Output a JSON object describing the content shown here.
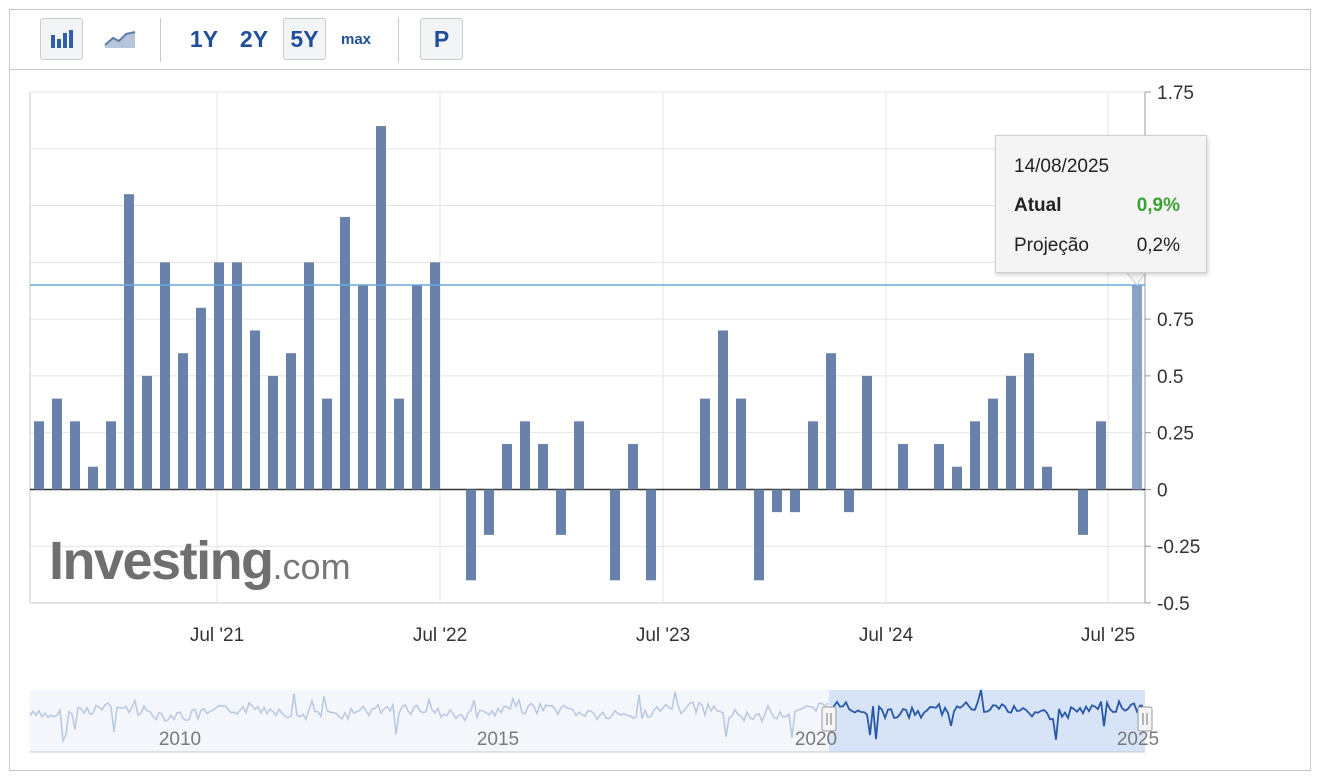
{
  "toolbar": {
    "buttons": [
      "1Y",
      "2Y",
      "5Y",
      "max",
      "P"
    ],
    "active": "5Y",
    "icons": [
      "bar-chart-icon",
      "area-chart-icon"
    ]
  },
  "logo": {
    "brand": "Investing",
    "suffix": ".com"
  },
  "tooltip": {
    "date": "14/08/2025",
    "actual_label": "Atual",
    "actual_value": "0,9%",
    "forecast_label": "Projeção",
    "forecast_value": "0,2%",
    "colors": {
      "actual": "#3aa233"
    }
  },
  "colors": {
    "bar": "#6882ac",
    "highlight_bar": "#8aa0c4",
    "reference_line": "#6aaae2",
    "navigator_line": "#2858a8",
    "navigator_fill": "#d7e3f7"
  },
  "chart_data": {
    "type": "bar",
    "ylim": [
      -0.5,
      1.75
    ],
    "yticks_labels": [
      "1.75",
      "0.75",
      "0.5",
      "0.25",
      "0",
      "-0.25",
      "-0.5"
    ],
    "yticks_values": [
      1.75,
      0.75,
      0.5,
      0.25,
      0,
      -0.25,
      -0.5
    ],
    "gridline_values": [
      1.75,
      1.5,
      1.25,
      1.0,
      0.75,
      0.5,
      0.25,
      0,
      -0.25,
      -0.5
    ],
    "x_labels": [
      "Jul '21",
      "Jul '22",
      "Jul '23",
      "Jul '24",
      "Jul '25"
    ],
    "reference_value": 0.9,
    "values": [
      0.3,
      0.4,
      0.3,
      0.1,
      0.3,
      1.3,
      0.5,
      1.0,
      0.6,
      0.8,
      1.0,
      1.0,
      0.7,
      0.5,
      0.6,
      1.0,
      0.4,
      1.2,
      0.9,
      1.6,
      0.4,
      0.9,
      1.0,
      null,
      -0.4,
      -0.2,
      0.2,
      0.3,
      0.2,
      -0.2,
      0.3,
      null,
      -0.4,
      0.2,
      -0.4,
      null,
      null,
      0.4,
      0.7,
      0.4,
      -0.4,
      -0.1,
      -0.1,
      0.3,
      0.6,
      -0.1,
      0.5,
      null,
      0.2,
      null,
      0.2,
      0.1,
      0.3,
      0.4,
      0.5,
      0.6,
      0.1,
      null,
      -0.2,
      0.3,
      null,
      0.9
    ],
    "navigator_labels": [
      "2010",
      "2015",
      "2020",
      "2025"
    ]
  }
}
